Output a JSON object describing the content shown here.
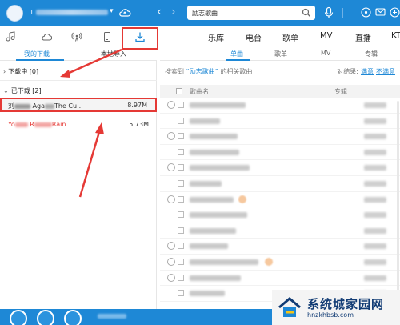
{
  "titlebar": {
    "user_prefix": "1",
    "caret": "▾",
    "search_text": "励志歌曲"
  },
  "leftnav": {
    "icons": [
      "music-note-icon",
      "cloud-icon",
      "radio-icon",
      "device-icon",
      "download-icon"
    ]
  },
  "categories": [
    "乐库",
    "电台",
    "歌单",
    "MV",
    "直播",
    "KT"
  ],
  "left_subtabs": {
    "my_downloads": "我的下载",
    "local_import": "本地导入"
  },
  "right_subtabs": {
    "single": "单曲",
    "playlist": "歌单",
    "mv": "MV",
    "album": "专辑"
  },
  "left_panel": {
    "downloading_label": "下载中",
    "downloading_count": "[0]",
    "downloaded_label": "已下载",
    "downloaded_count": "[2]",
    "songs": [
      {
        "name_prefix": "刘",
        "name_mid": "Aga",
        "name_suffix": "The Cu...",
        "size": "8.97M"
      },
      {
        "name_prefix": "Yo",
        "name_mid": "R",
        "name_suffix": "Rain",
        "size": "5.73M"
      }
    ]
  },
  "right_panel": {
    "search_prefix": "搜索到",
    "search_keyword": "“励志歌曲”",
    "search_suffix": "的相关歌曲",
    "filter_label": "对结果:",
    "filter_opt1": "满意",
    "filter_opt2": "不满意",
    "col_song": "歌曲名",
    "col_album": "专辑"
  },
  "watermark": {
    "text": "系统城",
    "text2": "家园网",
    "url": "hnzkhbsb.com"
  },
  "colors": {
    "brand_blue": "#1e88d6",
    "highlight_red": "#e53935"
  }
}
